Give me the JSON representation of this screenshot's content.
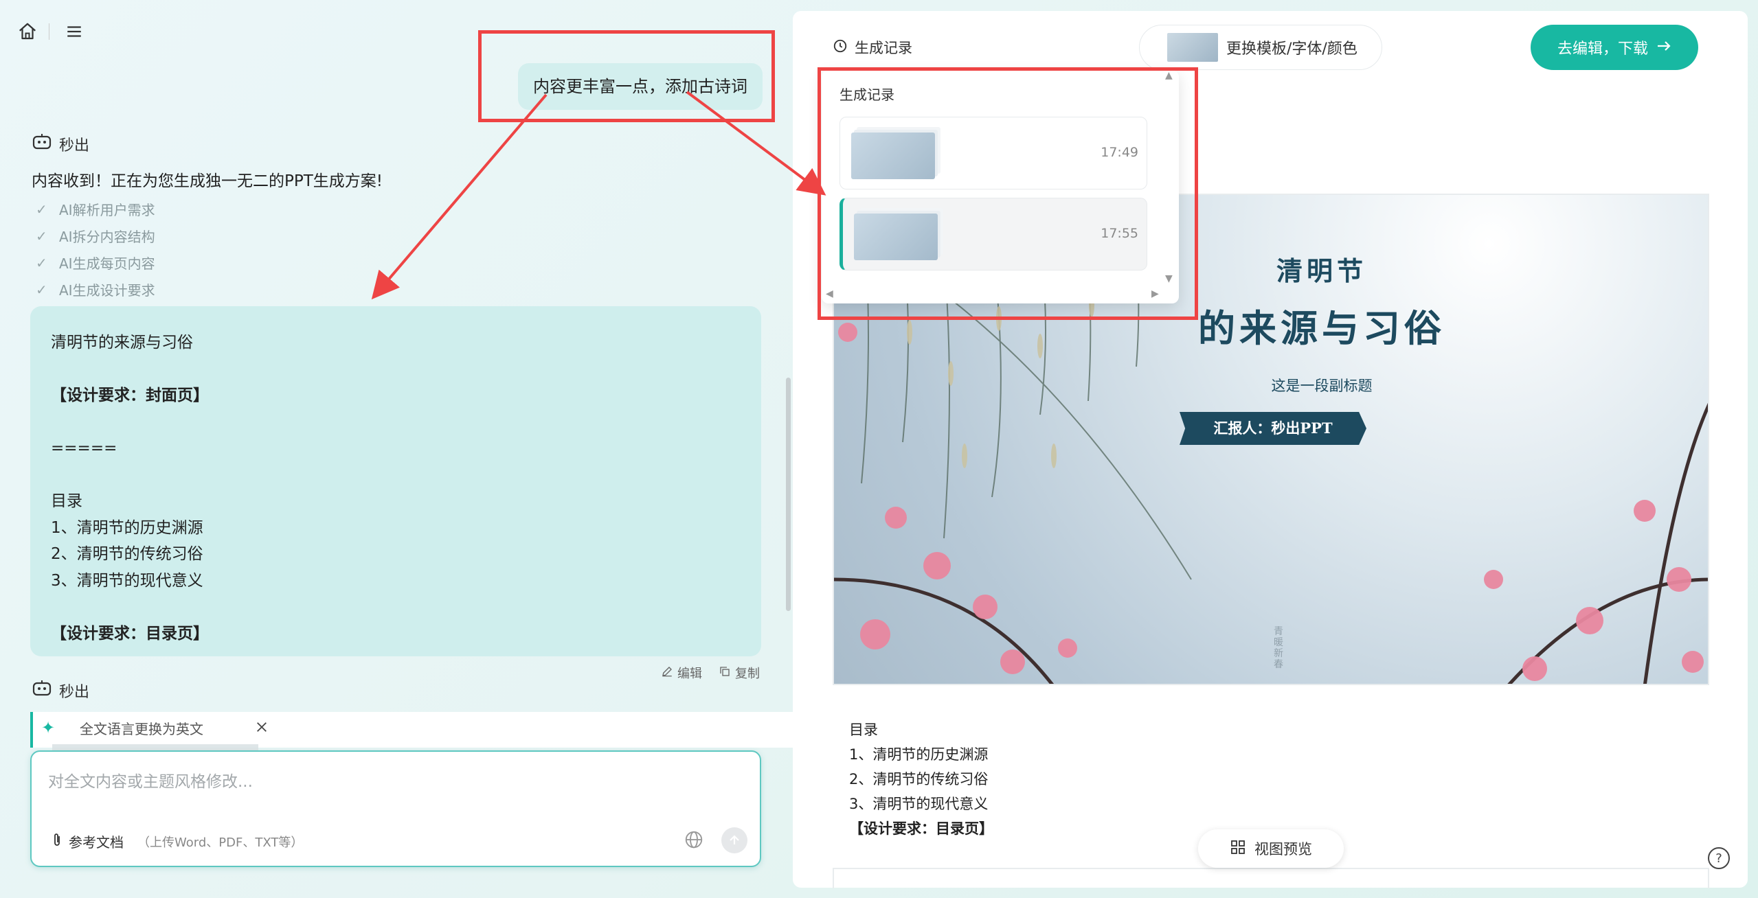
{
  "header": {
    "home_icon": "home-icon",
    "menu_icon": "menu-icon"
  },
  "chat": {
    "user_message": "内容更丰富一点，添加古诗词",
    "bot_name": "秒出",
    "bot_reply": "内容收到！正在为您生成独一无二的PPT生成方案!",
    "steps": [
      "AI解析用户需求",
      "AI拆分内容结构",
      "AI生成每页内容",
      "AI生成设计要求"
    ],
    "card_lines": [
      "清明节的来源与习俗",
      "",
      "【设计要求：封面页】",
      "",
      "=====",
      "",
      "目录",
      "1、清明节的历史渊源",
      "2、清明节的传统习俗",
      "3、清明节的现代意义",
      "",
      "【设计要求：目录页】"
    ],
    "edit_label": "编辑",
    "copy_label": "复制",
    "bot_name_2": "秒出",
    "suggestion": "全文语言更换为英文"
  },
  "input": {
    "placeholder": "对全文内容或主题风格修改...",
    "attach_label": "参考文档",
    "attach_hint": "（上传Word、PDF、TXT等）"
  },
  "toolbar": {
    "history_label": "生成记录",
    "template_label": "更换模板/字体/颜色",
    "primary_label": "去编辑，下载"
  },
  "history_dropdown": {
    "title": "生成记录",
    "records": [
      {
        "time": "17:49",
        "active": false
      },
      {
        "time": "17:55",
        "active": true
      }
    ]
  },
  "slide": {
    "title_line1": "清明节",
    "title_line2": "的来源与习俗",
    "subtitle": "这是一段副标题",
    "reporter": "汇报人：秒出PPT",
    "seal_text": "青暖新春"
  },
  "doc": {
    "lines": [
      "目录",
      "1、清明节的历史渊源",
      "2、清明节的传统习俗",
      "3、清明节的现代意义",
      "【设计要求：目录页】"
    ]
  },
  "floating": {
    "preview_label": "视图预览",
    "help": "?"
  },
  "colors": {
    "accent": "#18b8a2",
    "annotation": "#ee4444",
    "card": "#cfeeed",
    "slide_dark": "#1d4a5f"
  }
}
